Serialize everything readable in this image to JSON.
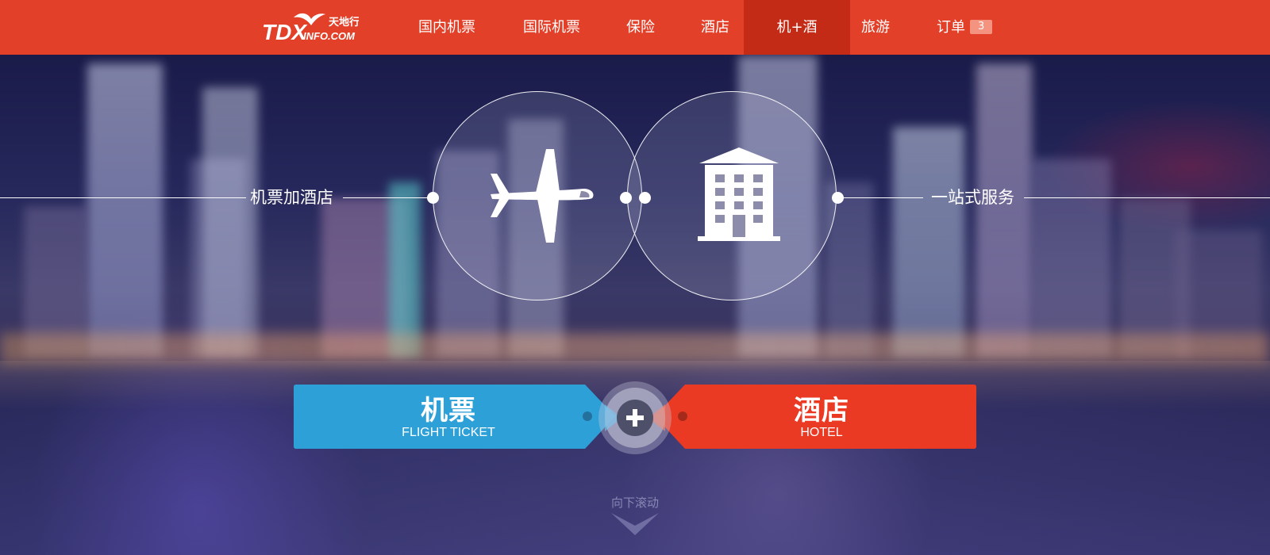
{
  "brand": {
    "logo_text": "TDX",
    "logo_domain": "INFO.COM",
    "logo_chinese": "天地行"
  },
  "nav": {
    "items": [
      {
        "label": "国内机票"
      },
      {
        "label": "国际机票"
      },
      {
        "label": "保险"
      },
      {
        "label": "酒店"
      },
      {
        "label": "机+酒"
      },
      {
        "label": "旅游"
      },
      {
        "label": "订单"
      }
    ],
    "active_index": 4,
    "order_count": "3"
  },
  "hero": {
    "left_label": "机票加酒店",
    "right_label": "一站式服务",
    "left_icon": "airplane-icon",
    "right_icon": "hotel-building-icon"
  },
  "actions": {
    "flight": {
      "title": "机票",
      "subtitle": "FLIGHT TICKET",
      "color": "#2ea0d8"
    },
    "hotel": {
      "title": "酒店",
      "subtitle": "HOTEL",
      "color": "#ea3a24"
    },
    "combine_icon": "plus-icon"
  },
  "scroll_hint": "向下滚动",
  "colors": {
    "topbar": "#e34029",
    "topbar_active": "#c42b17",
    "badge": "#f4937f"
  }
}
